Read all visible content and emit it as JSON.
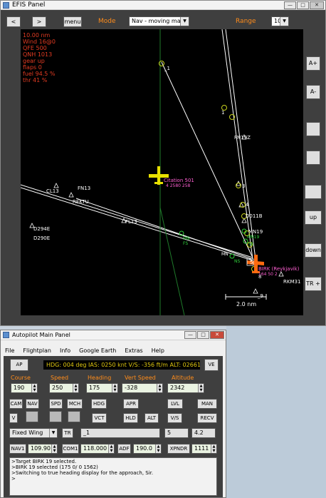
{
  "efis": {
    "title": "EFIS Panel",
    "toolbar": {
      "prev": "<",
      "next": ">",
      "menu": "menu",
      "mode_label": "Mode",
      "mode_value": "Nav - moving map",
      "range_label": "Range",
      "range_value": "10"
    },
    "info": [
      "10.00 nm",
      "Wind 16@0",
      "QFE 500",
      "QNH 1013",
      "gear up",
      "flaps 0",
      "fuel 94.5 %",
      "thr 41 %"
    ],
    "side_buttons": {
      "a_plus": "A+",
      "a_minus": "A-",
      "up": "up",
      "down": "down",
      "tr_plus": "TR +"
    },
    "map": {
      "waypoints": {
        "cl13": "CL13",
        "fn13": "FN13",
        "rektu": "REKTU",
        "fl13": "FL13",
        "d294e": "D294E",
        "d290e": "D290E",
        "fn19z": "FN19Z",
        "d011b": "D011B",
        "mn19": "MN19",
        "rkm31": "RKM31",
        "wp_1": "_1",
        "wp_9": "_9",
        "wp_3": "3",
        "wp_4": "4",
        "wp_5": "5",
        "wp_8": "8",
        "wp_1_b": "1"
      },
      "traffic": {
        "name": "Citation 501",
        "data": "4 2580 258"
      },
      "airport": {
        "name": "BIRK (Reykjavik)",
        "data": "164 50 2"
      },
      "green_labels": {
        "g1": "MN",
        "g2": "FS",
        "g3": "MN19",
        "g4": "SE",
        "g5": "NS",
        "g6": "MN"
      },
      "scale": "2.0 nm"
    }
  },
  "autopilot": {
    "title": "Autopilot Main Panel",
    "menu": [
      "File",
      "Flightplan",
      "Info",
      "Google Earth",
      "Extras",
      "Help"
    ],
    "ap_button": "AP",
    "ve_button": "VE",
    "status": "HDG: 004 deg IAS: 0250 knt V/S: -356 ft/m ALT: 02661 ft",
    "fields": {
      "course": {
        "label": "Course",
        "value": "190"
      },
      "speed": {
        "label": "Speed",
        "value": "250"
      },
      "heading": {
        "label": "Heading",
        "value": "175"
      },
      "vspeed": {
        "label": "Vert Speed",
        "value": "-328"
      },
      "altitude": {
        "label": "Altitude",
        "value": "2342"
      }
    },
    "buttons": {
      "cam": "CAM",
      "nav": "NAV",
      "spd": "SPD",
      "mch": "MCH",
      "hdg": "HDG",
      "apr": "APR",
      "lvl": "LVL",
      "man": "MAN",
      "v": "V",
      "vct": "VCT",
      "hld": "HLD",
      "alt": "ALT",
      "vs": "V/S",
      "recv": "RECV"
    },
    "aircraft_type": "Fixed Wing",
    "tr": "TR",
    "route_field": "_1",
    "field_5": "5",
    "field_42": "4.2",
    "radios": {
      "nav1": {
        "label": "NAV1",
        "value": "109.90"
      },
      "com1": {
        "label": "COM1",
        "value": "118.000"
      },
      "adf": {
        "label": "ADF",
        "value": "190.0"
      },
      "xpndr": {
        "label": "XPNDR",
        "value": "1111"
      }
    },
    "log": [
      ">Target BIRK 19 selected.",
      ">BIRK 19 selected (175   0/   0 1562)",
      ">Switching to true heading display for the approach, Sir.",
      ">"
    ]
  }
}
